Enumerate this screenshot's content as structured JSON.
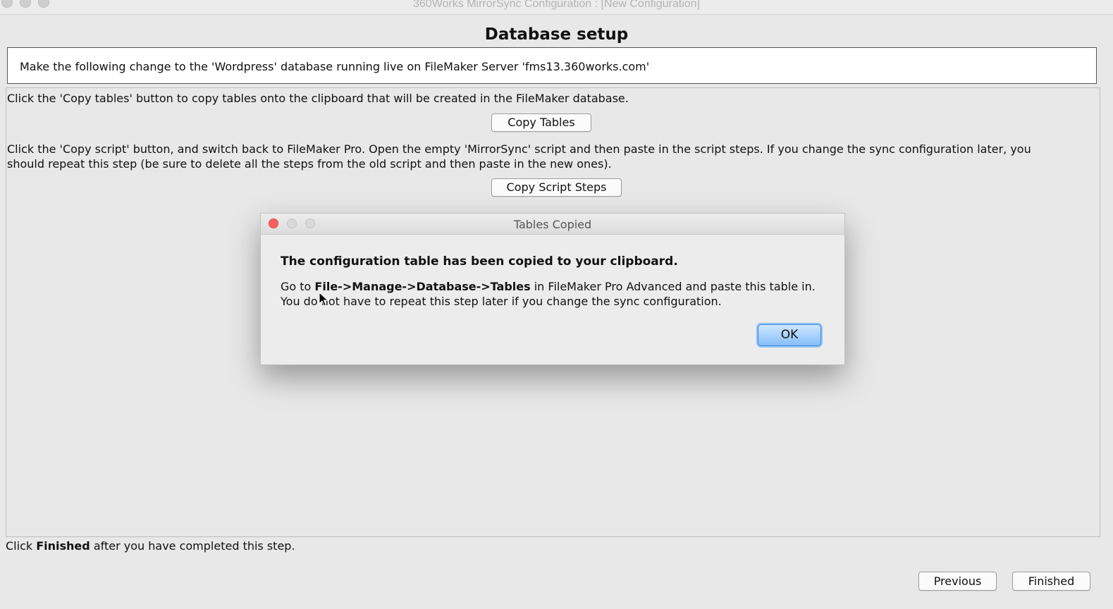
{
  "window": {
    "title": "360Works MirrorSync Configuration : [New Configuration]"
  },
  "page": {
    "heading": "Database setup",
    "info": "Make the following change to the 'Wordpress' database running live on FileMaker Server 'fms13.360works.com'",
    "copy_tables_instruction": "Click the 'Copy tables' button to copy tables onto the clipboard that will be created in the FileMaker database.",
    "copy_tables_button": "Copy Tables",
    "copy_script_instruction_1": "Click the 'Copy script' button, and switch back to FileMaker Pro. Open the empty 'MirrorSync' script and then paste in the script steps. If you change the sync configuration later, you",
    "copy_script_instruction_2": "should repeat this step (be sure to delete all the steps from the old script and then paste in the new ones).",
    "copy_script_button": "Copy Script Steps",
    "footer_prefix": "Click ",
    "footer_bold": "Finished",
    "footer_suffix": " after you have completed this step."
  },
  "nav": {
    "previous": "Previous",
    "finished": "Finished"
  },
  "dialog": {
    "title": "Tables Copied",
    "heading": "The configuration table has been copied to your clipboard.",
    "line1_prefix": "Go to ",
    "line1_path": "File->Manage->Database->Tables",
    "line1_suffix": " in FileMaker Pro Advanced and paste this table in.",
    "line2": "You do not have to repeat this step later if you change the sync configuration.",
    "ok": "OK"
  },
  "colors": {
    "close": "#fc605c",
    "ok_button": "#86bff8"
  },
  "icons": [
    "close-icon",
    "minimize-icon",
    "zoom-icon",
    "mouse-pointer-icon"
  ]
}
